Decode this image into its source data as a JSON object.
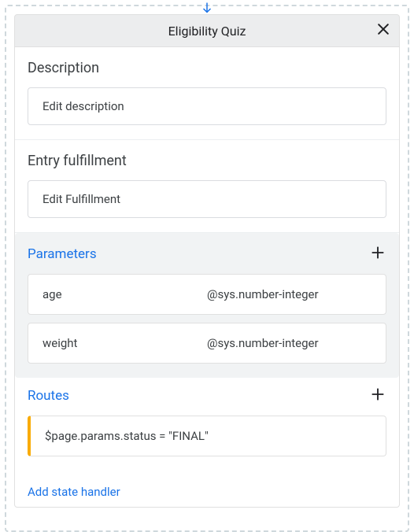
{
  "header": {
    "title": "Eligibility Quiz"
  },
  "sections": {
    "description": {
      "label": "Description",
      "edit_label": "Edit description"
    },
    "entry_fulfillment": {
      "label": "Entry fulfillment",
      "edit_label": "Edit Fulfillment"
    },
    "parameters": {
      "label": "Parameters",
      "items": [
        {
          "name": "age",
          "type": "@sys.number-integer"
        },
        {
          "name": "weight",
          "type": "@sys.number-integer"
        }
      ]
    },
    "routes": {
      "label": "Routes",
      "items": [
        {
          "condition": "$page.params.status = \"FINAL\""
        }
      ]
    },
    "add_state_handler": "Add state handler"
  },
  "icons": {
    "arrow": "arrow-down-icon",
    "close": "close-icon",
    "plus": "plus-icon"
  }
}
